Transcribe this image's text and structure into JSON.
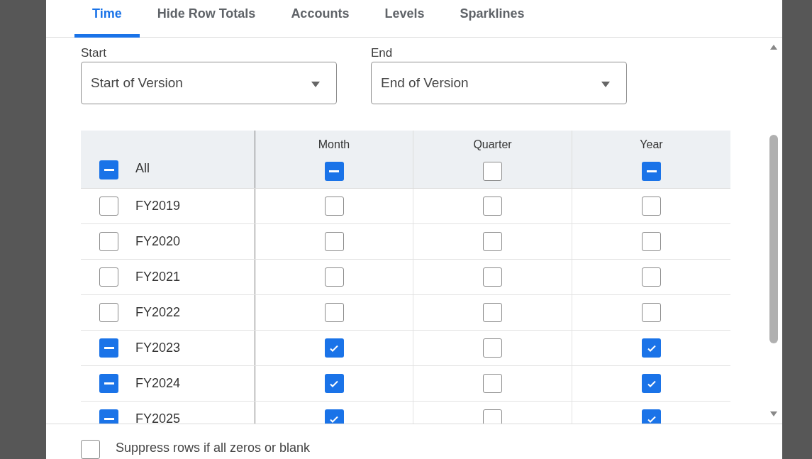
{
  "tabs": [
    {
      "label": "Time",
      "selected": true
    },
    {
      "label": "Hide Row Totals",
      "selected": false
    },
    {
      "label": "Accounts",
      "selected": false
    },
    {
      "label": "Levels",
      "selected": false
    },
    {
      "label": "Sparklines",
      "selected": false
    }
  ],
  "start": {
    "label": "Start",
    "value": "Start of Version"
  },
  "end": {
    "label": "End",
    "value": "End of Version"
  },
  "table": {
    "columns": [
      "Month",
      "Quarter",
      "Year"
    ],
    "header_row": {
      "label": "All",
      "row_check": {
        "indeterminate": true
      },
      "cells": [
        {
          "indeterminate": true
        },
        {
          "checked": false
        },
        {
          "indeterminate": true
        }
      ]
    },
    "rows": [
      {
        "label": "FY2019",
        "row_check": {
          "checked": false
        },
        "cells": [
          {
            "checked": false
          },
          {
            "checked": false
          },
          {
            "checked": false
          }
        ]
      },
      {
        "label": "FY2020",
        "row_check": {
          "checked": false
        },
        "cells": [
          {
            "checked": false
          },
          {
            "checked": false
          },
          {
            "checked": false
          }
        ]
      },
      {
        "label": "FY2021",
        "row_check": {
          "checked": false
        },
        "cells": [
          {
            "checked": false
          },
          {
            "checked": false
          },
          {
            "checked": false
          }
        ]
      },
      {
        "label": "FY2022",
        "row_check": {
          "checked": false
        },
        "cells": [
          {
            "checked": false
          },
          {
            "checked": false
          },
          {
            "checked": false
          }
        ]
      },
      {
        "label": "FY2023",
        "row_check": {
          "indeterminate": true
        },
        "cells": [
          {
            "checked": true
          },
          {
            "checked": false
          },
          {
            "checked": true
          }
        ]
      },
      {
        "label": "FY2024",
        "row_check": {
          "indeterminate": true
        },
        "cells": [
          {
            "checked": true
          },
          {
            "checked": false
          },
          {
            "checked": true
          }
        ]
      },
      {
        "label": "FY2025",
        "row_check": {
          "indeterminate": true
        },
        "cells": [
          {
            "checked": true
          },
          {
            "checked": false
          },
          {
            "checked": true
          }
        ]
      }
    ]
  },
  "suppress": {
    "label": "Suppress rows if all zeros or blank",
    "checked": false
  }
}
